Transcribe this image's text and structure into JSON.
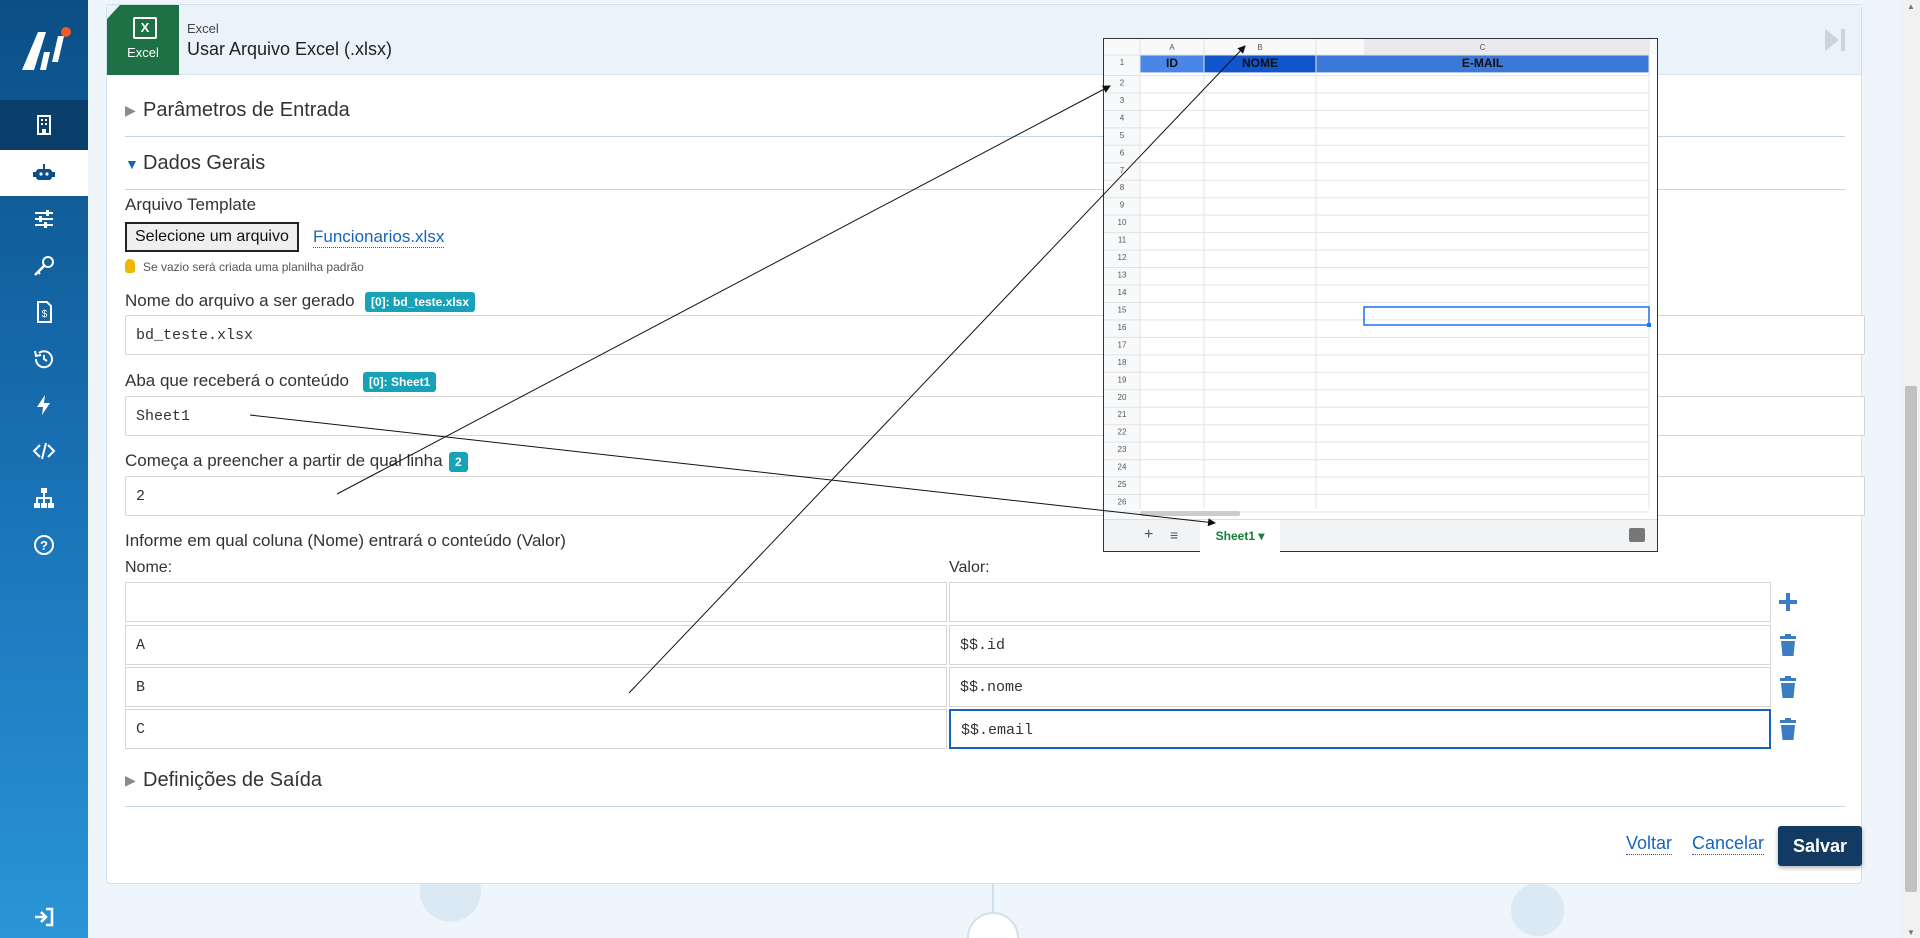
{
  "header": {
    "app_small": "Excel",
    "title": "Usar Arquivo Excel (.xlsx)",
    "badge_label": "Excel"
  },
  "sections": {
    "input_params": "Parâmetros de Entrada",
    "general": "Dados Gerais",
    "output": "Definições de Saída"
  },
  "template": {
    "label": "Arquivo Template",
    "file_button": "Selecione um arquivo",
    "file_name": "Funcionarios.xlsx",
    "hint": "Se vazio será criada uma planilha padrão"
  },
  "filename_field": {
    "label": "Nome do arquivo a ser gerado",
    "tag": "[0]: bd_teste.xlsx",
    "value": "bd_teste.xlsx"
  },
  "sheet_field": {
    "label": "Aba que receberá o conteúdo",
    "tag": "[0]: Sheet1",
    "value": "Sheet1"
  },
  "row_field": {
    "label": "Começa a preencher a partir de qual linha",
    "tag": "2",
    "value": "2"
  },
  "mapping": {
    "label": "Informe em qual coluna (Nome) entrará o conteúdo (Valor)",
    "name_header": "Nome:",
    "value_header": "Valor:",
    "rows": [
      {
        "name": "",
        "value": ""
      },
      {
        "name": "A",
        "value": "$$.id"
      },
      {
        "name": "B",
        "value": "$$.nome"
      },
      {
        "name": "C",
        "value": "$$.email"
      }
    ]
  },
  "actions": {
    "back": "Voltar",
    "cancel": "Cancelar",
    "save": "Salvar"
  },
  "spreadsheet": {
    "col_letters": [
      "A",
      "B",
      "C"
    ],
    "headers": [
      "ID",
      "NOME",
      "E-MAIL"
    ],
    "row_numbers": [
      "1",
      "2",
      "3",
      "4",
      "5",
      "6",
      "7",
      "8",
      "9",
      "10",
      "11",
      "12",
      "13",
      "14",
      "15",
      "16",
      "17",
      "18",
      "19",
      "20",
      "21",
      "22",
      "23",
      "24",
      "25",
      "26"
    ],
    "tab": "Sheet1"
  },
  "colors": {
    "accent": "#1565c0",
    "save": "#123a62",
    "tag": "#17a2b8",
    "excel": "#1e7145",
    "sheet_header": "#3c78d8"
  }
}
